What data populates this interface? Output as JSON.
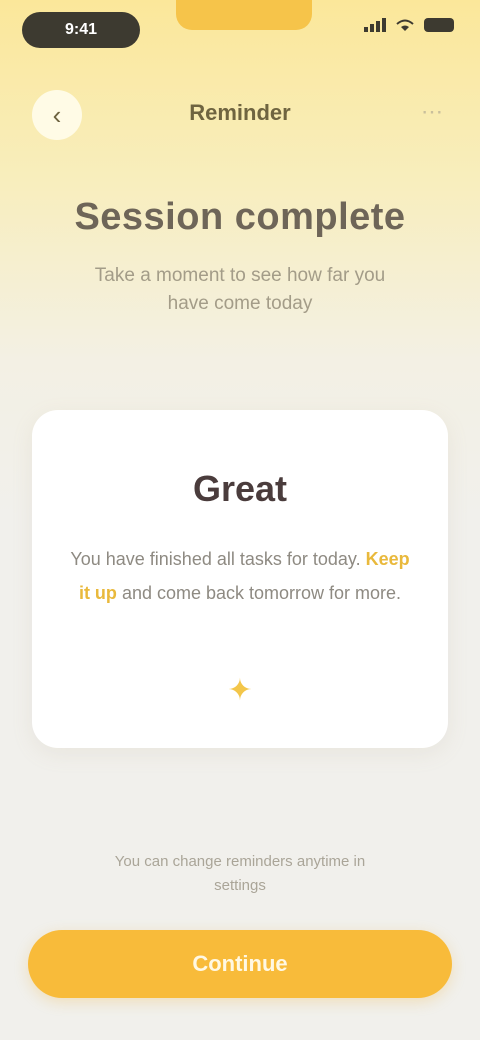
{
  "status_bar": {
    "time": "9:41",
    "icons": [
      "signal-icon",
      "wifi-icon",
      "battery-icon"
    ]
  },
  "nav": {
    "title": "Reminder",
    "back_icon": "chevron-left-icon",
    "action_icon": "more-icon"
  },
  "hero": {
    "title": "Session complete",
    "subtitle": "Take a moment to see how far you have come today"
  },
  "card": {
    "heading": "Great",
    "body_prefix": "You have finished all tasks for today.",
    "body_highlight": "Keep it up",
    "body_suffix": "and come back tomorrow for more.",
    "icon": "sun-icon"
  },
  "footer": {
    "note": "You can change reminders anytime in settings"
  },
  "cta": {
    "label": "Continue"
  },
  "colors": {
    "accent": "#f8bb3a",
    "background_top": "#fbe79a",
    "background_bottom": "#f1f0ec",
    "card": "#ffffff"
  }
}
